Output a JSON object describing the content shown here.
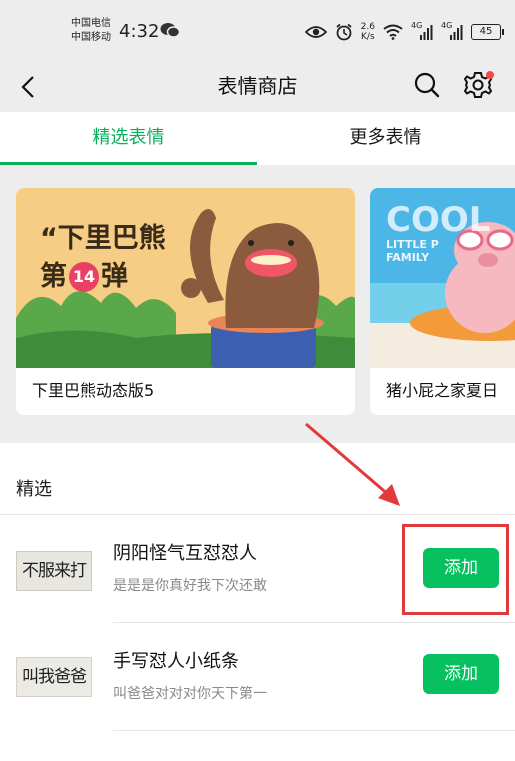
{
  "status_bar": {
    "carrier_1": "中国电信",
    "carrier_2": "中国移动",
    "time": "4:32",
    "net_speed_value": "2.6",
    "net_speed_unit": "K/s",
    "signal_1_label": "4G",
    "signal_2_label": "4G",
    "battery": "45"
  },
  "header": {
    "title": "表情商店"
  },
  "tabs": [
    {
      "label": "精选表情",
      "active": true
    },
    {
      "label": "更多表情",
      "active": false
    }
  ],
  "banners": [
    {
      "caption": "下里巴熊动态版5",
      "art_text_line1": "“下里巴熊",
      "art_text_line2a": "第",
      "art_text_badge": "14",
      "art_text_line2b": "弹"
    },
    {
      "caption": "猪小屁之家夏日 ",
      "art_text_line1": "COOL",
      "art_text_line2": "LITTLE P",
      "art_text_line3": "FAMILY"
    }
  ],
  "featured": {
    "section_title": "精选",
    "items": [
      {
        "thumb_text": "不服来打",
        "name": "阴阳怪气互怼怼人",
        "desc": "是是是你真好我下次还敢",
        "button": "添加"
      },
      {
        "thumb_text": "叫我爸爸",
        "name": "手写怼人小纸条",
        "desc": "叫爸爸对对对你天下第一",
        "button": "添加"
      }
    ]
  },
  "colors": {
    "accent": "#07c160",
    "tab_active": "#07b05c",
    "annotation": "#e03a3a",
    "background": "#ededed"
  }
}
